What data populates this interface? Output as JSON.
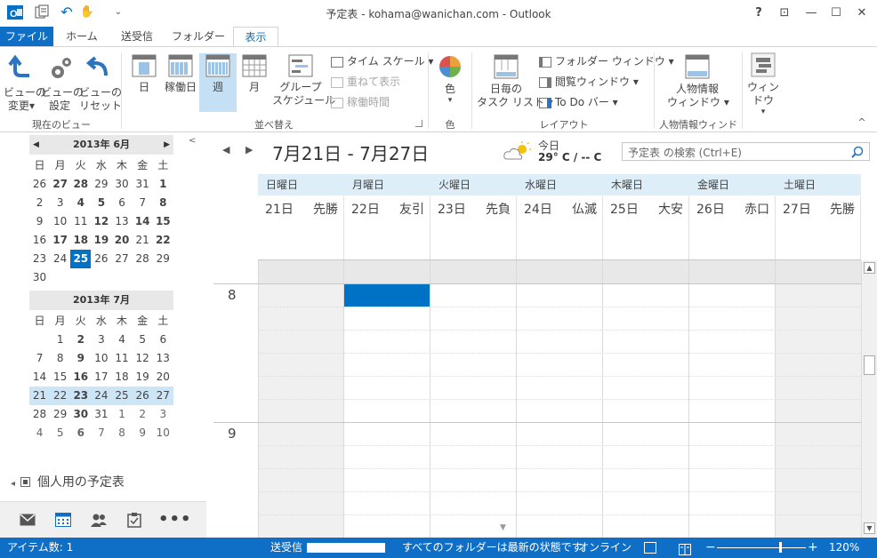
{
  "window": {
    "title": "予定表 - kohama@wanichan.com - Outlook",
    "help": "?",
    "restore_ribbon": "⊡",
    "minimize": "—",
    "maximize": "☐",
    "close": "✕"
  },
  "qat": {
    "app_icon": "outlook-icon",
    "send_receive_icon": "send-receive-icon",
    "undo": "↶",
    "touch": "✋",
    "more": "⌄"
  },
  "tabs": [
    "ファイル",
    "ホーム",
    "送受信",
    "フォルダー",
    "表示"
  ],
  "ribbon": {
    "groups": {
      "current_view": {
        "label": "現在のビュー",
        "change_view": "ビューの\n変更▾",
        "view_settings": "ビューの\n設定",
        "reset_view": "ビューの\nリセット"
      },
      "arrangement": {
        "label": "並べ替え",
        "day": "日",
        "work_week": "稼働日",
        "week": "週",
        "month": "月",
        "schedule": "グループ\nスケジュール",
        "time_scale": "タイム スケール ▾",
        "overlay": "重ねて表示",
        "working_hours": "稼働時間"
      },
      "color": {
        "label": "色",
        "color": "色"
      },
      "layout": {
        "label": "レイアウト",
        "daily_task_list": "日毎の\nタスク リスト ▾",
        "folder_pane": "フォルダー ウィンドウ ▾",
        "reading_pane": "閲覧ウィンドウ ▾",
        "todo_bar": "To Do バー ▾"
      },
      "people": {
        "label": "人物情報ウィンドウ",
        "people_pane": "人物情報\nウィンドウ ▾"
      },
      "window": {
        "label": "",
        "window": "ウィンドウ"
      }
    },
    "collapse": "^"
  },
  "nav": {
    "month1": {
      "title": "2013年 6月",
      "prev": "◀",
      "next": "▶",
      "dow": [
        "日",
        "月",
        "火",
        "水",
        "木",
        "金",
        "土"
      ],
      "weeks": [
        [
          "26",
          "27",
          "28",
          "29",
          "30",
          "31",
          "1"
        ],
        [
          "2",
          "3",
          "4",
          "5",
          "6",
          "7",
          "8"
        ],
        [
          "9",
          "10",
          "11",
          "12",
          "13",
          "14",
          "15"
        ],
        [
          "16",
          "17",
          "18",
          "19",
          "20",
          "21",
          "22"
        ],
        [
          "23",
          "24",
          "25",
          "26",
          "27",
          "28",
          "29"
        ],
        [
          "30",
          "",
          "",
          "",
          "",
          "",
          ""
        ]
      ]
    },
    "month2": {
      "title": "2013年 7月",
      "dow": [
        "日",
        "月",
        "火",
        "水",
        "木",
        "金",
        "土"
      ],
      "weeks": [
        [
          "",
          "1",
          "2",
          "3",
          "4",
          "5",
          "6"
        ],
        [
          "7",
          "8",
          "9",
          "10",
          "11",
          "12",
          "13"
        ],
        [
          "14",
          "15",
          "16",
          "17",
          "18",
          "19",
          "20"
        ],
        [
          "21",
          "22",
          "23",
          "24",
          "25",
          "26",
          "27"
        ],
        [
          "28",
          "29",
          "30",
          "31",
          "1",
          "2",
          "3"
        ],
        [
          "4",
          "5",
          "6",
          "7",
          "8",
          "9",
          "10"
        ]
      ]
    },
    "calendar_group": "個人用の予定表",
    "collapse": "◂",
    "bottom_icons": [
      "mail-icon",
      "calendar-icon",
      "people-icon",
      "tasks-icon",
      "more-icon"
    ]
  },
  "main": {
    "range_title": "7月21日 - 7月27日",
    "weather": {
      "label": "今日",
      "temp": "29° C / -- C"
    },
    "search_placeholder": "予定表 の検索 (Ctrl+E)",
    "days": [
      {
        "dow": "日曜日",
        "date": "21日",
        "rokuyo": "先勝"
      },
      {
        "dow": "月曜日",
        "date": "22日",
        "rokuyo": "友引"
      },
      {
        "dow": "火曜日",
        "date": "23日",
        "rokuyo": "先負"
      },
      {
        "dow": "水曜日",
        "date": "24日",
        "rokuyo": "仏滅"
      },
      {
        "dow": "木曜日",
        "date": "25日",
        "rokuyo": "大安"
      },
      {
        "dow": "金曜日",
        "date": "26日",
        "rokuyo": "赤口"
      },
      {
        "dow": "土曜日",
        "date": "27日",
        "rokuyo": "先勝"
      }
    ],
    "hours": [
      "8",
      "9"
    ]
  },
  "status": {
    "items": "アイテム数: 1",
    "send_receive": "送受信",
    "folder_status": "すべてのフォルダーは最新の状態です。",
    "online": "オンライン",
    "zoom": "120%",
    "zoom_minus": "−",
    "zoom_plus": "+"
  },
  "colors": {
    "accent": "#0f6fc6",
    "selected": "#0072c6",
    "week_highlight": "#cde6f7",
    "header_bg": "#deeef9"
  }
}
